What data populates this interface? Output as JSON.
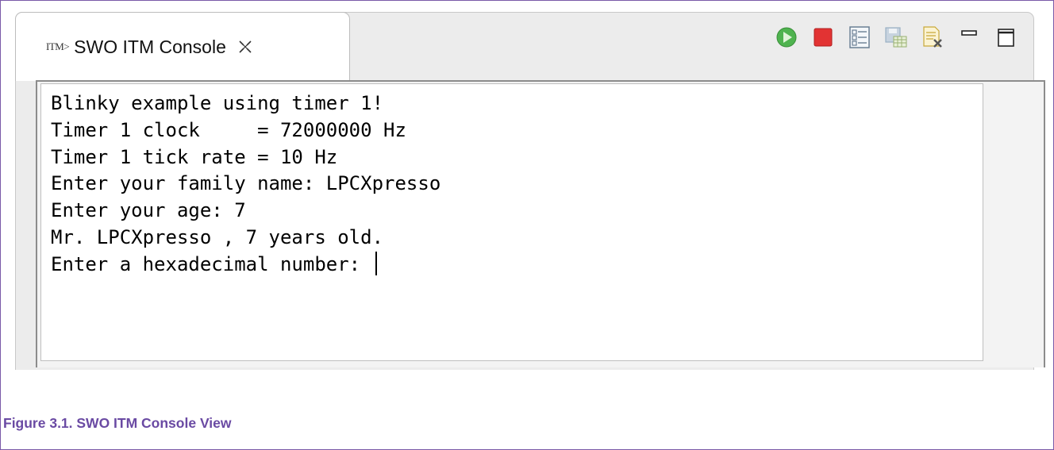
{
  "tab": {
    "icon_text": "ITM>",
    "title": "SWO ITM Console"
  },
  "toolbar": {
    "buttons": [
      {
        "name": "run-icon",
        "color": "#4caf50"
      },
      {
        "name": "stop-icon",
        "color": "#e03030"
      },
      {
        "name": "settings-list-icon",
        "color": "#6a7f93"
      },
      {
        "name": "save-table-icon",
        "color": "#9ab0c4"
      },
      {
        "name": "clear-icon",
        "color": "#d8b640"
      },
      {
        "name": "minimize-icon"
      },
      {
        "name": "maximize-icon"
      }
    ]
  },
  "console": {
    "lines": [
      "Blinky example using timer 1!",
      "Timer 1 clock     = 72000000 Hz",
      "Timer 1 tick rate = 10 Hz",
      "Enter your family name: LPCXpresso",
      "Enter your age: 7",
      "Mr. LPCXpresso , 7 years old.",
      "Enter a hexadecimal number: "
    ]
  },
  "caption": "Figure 3.1. SWO ITM Console View"
}
